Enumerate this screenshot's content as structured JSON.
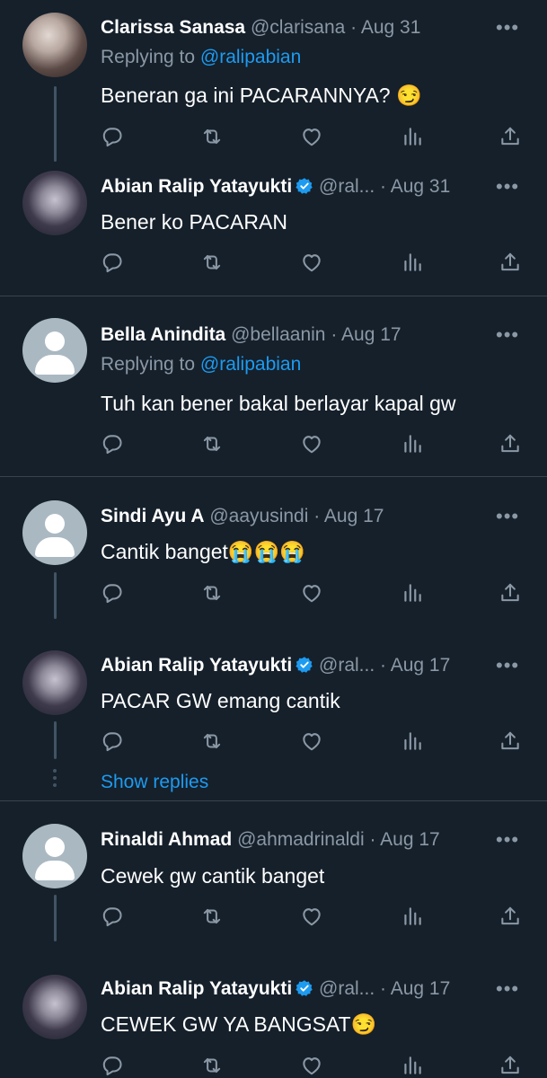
{
  "colors": {
    "background": "#15202b",
    "divider": "#38444d",
    "secondary_text": "#8b98a5",
    "link": "#1d9bf0",
    "verified": "#1d9bf0"
  },
  "tweets": [
    {
      "name": "Clarissa Sanasa",
      "handle": "@clarisana",
      "sep": "·",
      "time": "Aug 31",
      "replying_prefix": "Replying to",
      "replying_to": "@ralipabian",
      "text": "Beneran ga ini PACARANNYA? 😏",
      "avatar": "photo-avatar",
      "more": "•••"
    },
    {
      "name": "Abian Ralip Yatayukti",
      "handle": "@ral...",
      "sep": "·",
      "time": "Aug 31",
      "text": "Bener ko PACARAN",
      "verified": true,
      "avatar": "face-avatar",
      "more": "•••"
    },
    {
      "name": "Bella Anindita",
      "handle": "@bellaanin",
      "sep": "·",
      "time": "Aug 17",
      "replying_prefix": "Replying to",
      "replying_to": "@ralipabian",
      "text": "Tuh kan bener bakal berlayar kapal gw",
      "avatar": "default-avatar",
      "more": "•••"
    },
    {
      "name": "Sindi Ayu A",
      "handle": "@aayusindi",
      "sep": "·",
      "time": "Aug 17",
      "text": "Cantik banget😭😭😭",
      "avatar": "default-avatar",
      "more": "•••"
    },
    {
      "name": "Abian Ralip Yatayukti",
      "handle": "@ral...",
      "sep": "·",
      "time": "Aug 17",
      "text": "PACAR GW emang cantik",
      "verified": true,
      "avatar": "face-avatar",
      "more": "•••",
      "show_replies": "Show replies"
    },
    {
      "name": "Rinaldi Ahmad",
      "handle": "@ahmadrinaldi",
      "sep": "·",
      "time": "Aug 17",
      "text": "Cewek gw cantik banget",
      "avatar": "default-avatar",
      "more": "•••"
    },
    {
      "name": "Abian Ralip Yatayukti",
      "handle": "@ral...",
      "sep": "·",
      "time": "Aug 17",
      "text": "CEWEK GW YA BANGSAT😏",
      "verified": true,
      "avatar": "face-avatar",
      "more": "•••"
    }
  ],
  "action_icons": [
    "reply-icon",
    "retweet-icon",
    "like-icon",
    "analytics-icon",
    "share-icon"
  ]
}
